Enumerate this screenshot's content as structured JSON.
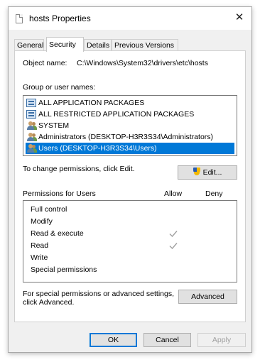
{
  "window": {
    "title": "hosts Properties",
    "close_symbol": "✕"
  },
  "tabs": [
    {
      "label": "General",
      "active": false
    },
    {
      "label": "Security",
      "active": true
    },
    {
      "label": "Details",
      "active": false
    },
    {
      "label": "Previous Versions",
      "active": false
    }
  ],
  "security": {
    "object_name_label": "Object name:",
    "object_name_value": "C:\\Windows\\System32\\drivers\\etc\\hosts",
    "group_label": "Group or user names:",
    "groups": [
      {
        "name": "ALL APPLICATION PACKAGES",
        "icon": "package-icon",
        "selected": false
      },
      {
        "name": "ALL RESTRICTED APPLICATION PACKAGES",
        "icon": "package-icon",
        "selected": false
      },
      {
        "name": "SYSTEM",
        "icon": "users-icon",
        "selected": false
      },
      {
        "name": "Administrators (DESKTOP-H3R3S34\\Administrators)",
        "icon": "users-icon",
        "selected": false
      },
      {
        "name": "Users (DESKTOP-H3R3S34\\Users)",
        "icon": "users-icon",
        "selected": true
      }
    ],
    "change_text": "To change permissions, click Edit.",
    "edit_label": "Edit...",
    "perm_header": "Permissions for Users",
    "allow_header": "Allow",
    "deny_header": "Deny",
    "permissions": [
      {
        "name": "Full control",
        "allow": false,
        "deny": false
      },
      {
        "name": "Modify",
        "allow": false,
        "deny": false
      },
      {
        "name": "Read & execute",
        "allow": true,
        "deny": false
      },
      {
        "name": "Read",
        "allow": true,
        "deny": false
      },
      {
        "name": "Write",
        "allow": false,
        "deny": false
      },
      {
        "name": "Special permissions",
        "allow": false,
        "deny": false
      }
    ],
    "advanced_text_line1": "For special permissions or advanced settings,",
    "advanced_text_line2": "click Advanced.",
    "advanced_label": "Advanced"
  },
  "footer": {
    "ok_label": "OK",
    "cancel_label": "Cancel",
    "apply_label": "Apply"
  },
  "colors": {
    "selection": "#0078d7",
    "checkmark": "#a0a0a0"
  }
}
